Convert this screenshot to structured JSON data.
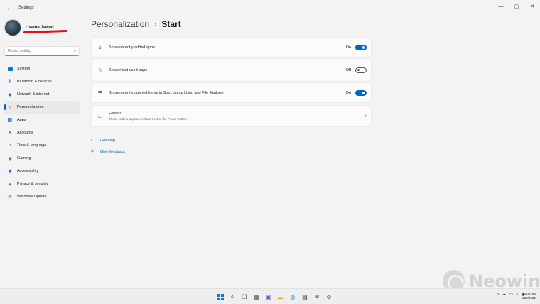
{
  "window": {
    "title": "Settings",
    "back_glyph": "←",
    "min_glyph": "—",
    "max_glyph": "▢",
    "close_glyph": "✕"
  },
  "profile": {
    "name": "Usama Jawad"
  },
  "search": {
    "placeholder": "Find a setting",
    "icon": "search-icon"
  },
  "sidebar": {
    "items": [
      {
        "label": "System",
        "icon": "monitor-icon"
      },
      {
        "label": "Bluetooth & devices",
        "icon": "bluetooth-icon"
      },
      {
        "label": "Network & internet",
        "icon": "wifi-icon"
      },
      {
        "label": "Personalization",
        "icon": "brush-icon",
        "active": true
      },
      {
        "label": "Apps",
        "icon": "apps-icon"
      },
      {
        "label": "Accounts",
        "icon": "person-icon"
      },
      {
        "label": "Time & language",
        "icon": "clock-globe-icon"
      },
      {
        "label": "Gaming",
        "icon": "gamepad-icon"
      },
      {
        "label": "Accessibility",
        "icon": "accessibility-icon"
      },
      {
        "label": "Privacy & security",
        "icon": "shield-icon"
      },
      {
        "label": "Windows Update",
        "icon": "update-icon"
      }
    ]
  },
  "breadcrumb": {
    "parent": "Personalization",
    "separator": "›",
    "current": "Start"
  },
  "settings": [
    {
      "label": "Show recently added apps",
      "icon": "download-icon",
      "state": "On",
      "on": true
    },
    {
      "label": "Show most used apps",
      "icon": "star-icon",
      "state": "Off",
      "on": false
    },
    {
      "label": "Show recently opened items in Start, Jump Lists, and File Explorer",
      "icon": "list-icon",
      "state": "On",
      "on": true
    },
    {
      "label": "Folders",
      "sub": "These folders appear on Start next to the Power button",
      "icon": "folder-icon"
    }
  ],
  "links": {
    "help": "Get help",
    "feedback": "Give feedback"
  },
  "watermark": {
    "text": "Neowin"
  },
  "taskbar": {
    "time": "10:05 AM",
    "date": "8/26/2021"
  },
  "colors": {
    "accent": "#0067c0",
    "background": "#f3f3f3",
    "card": "#fbfbfb"
  }
}
